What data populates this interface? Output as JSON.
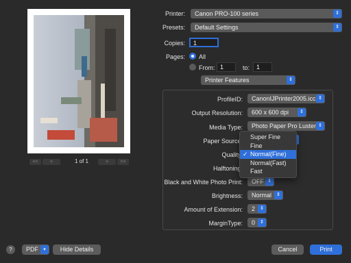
{
  "printer": {
    "label": "Printer:",
    "value": "Canon PRO-100 series"
  },
  "presets": {
    "label": "Presets:",
    "value": "Default Settings"
  },
  "copies": {
    "label": "Copies:",
    "value": "1"
  },
  "pages": {
    "label": "Pages:",
    "all_label": "All",
    "from_label": "From:",
    "from_value": "1",
    "to_label": "to:",
    "to_value": "1"
  },
  "panel_select": "Printer Features",
  "features": {
    "profile_id": {
      "label": "ProfileID:",
      "value": "CanonIJPrinter2005.icc"
    },
    "output_resolution": {
      "label": "Output Resolution:",
      "value": "600 x 600 dpi"
    },
    "media_type": {
      "label": "Media Type:",
      "value": "Photo Paper Pro Luster"
    },
    "paper_source": {
      "label": "Paper Source:"
    },
    "quality": {
      "label": "Quality:"
    },
    "halftoning": {
      "label": "Halftoning:"
    },
    "bw_photo_print": {
      "label": "Black and White Photo Print:",
      "value": "OFF"
    },
    "brightness": {
      "label": "Brightness:",
      "value": "Normal"
    },
    "amount_of_extension": {
      "label": "Amount of Extension:",
      "value": "2"
    },
    "margin_type": {
      "label": "MarginType:",
      "value": "0"
    }
  },
  "quality_menu": {
    "options": [
      "Super Fine",
      "Fine",
      "Normal(Fine)",
      "Normal(Fast)",
      "Fast"
    ],
    "selected": "Normal(Fine)",
    "check": "✓"
  },
  "preview": {
    "page_indicator": "1 of 1",
    "first": "<<",
    "prev": "<",
    "next": ">",
    "last": ">>"
  },
  "footer": {
    "help": "?",
    "pdf": "PDF",
    "hide_details": "Hide Details",
    "cancel": "Cancel",
    "print": "Print"
  },
  "colors": {
    "accent": "#2f6fd9",
    "background": "#2a2a2a",
    "control": "#5a5a5a"
  }
}
